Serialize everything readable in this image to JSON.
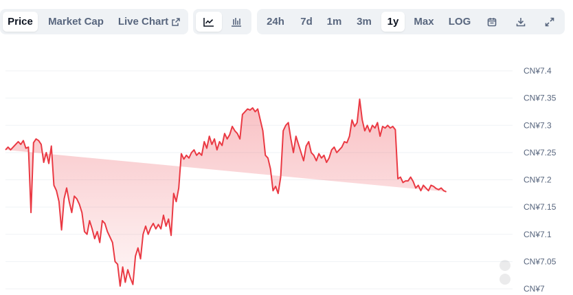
{
  "toolbar": {
    "tab_price": "Price",
    "tab_market_cap": "Market Cap",
    "tab_live_chart": "Live Chart",
    "range_24h": "24h",
    "range_7d": "7d",
    "range_1m": "1m",
    "range_3m": "3m",
    "range_1y": "1y",
    "range_max": "Max",
    "scale_log": "LOG"
  },
  "colors": {
    "line": "#ea3943",
    "fill_top": "#ea3943",
    "grid": "#eff2f5"
  },
  "chart_data": {
    "type": "area",
    "ylim": [
      7.0,
      7.4
    ],
    "y_ticks": [
      7.4,
      7.35,
      7.3,
      7.25,
      7.2,
      7.15,
      7.1,
      7.05,
      7.0
    ],
    "y_tick_labels": [
      "CN¥7.4",
      "CN¥7.35",
      "CN¥7.3",
      "CN¥7.25",
      "CN¥7.2",
      "CN¥7.15",
      "CN¥7.1",
      "CN¥7.05",
      "CN¥7"
    ],
    "x": [
      0,
      1,
      2,
      3,
      4,
      5,
      6,
      7,
      8,
      9,
      10,
      11,
      12,
      13,
      14,
      15,
      16,
      17,
      18,
      19,
      20,
      21,
      22,
      23,
      24,
      25,
      26,
      27,
      28,
      29,
      30,
      31,
      32,
      33,
      34,
      35,
      36,
      37,
      38,
      39,
      40,
      41,
      42,
      43,
      44,
      45,
      46,
      47,
      48,
      49,
      50,
      51,
      52,
      53,
      54,
      55,
      56,
      57,
      58,
      59,
      60,
      61,
      62,
      63,
      64,
      65,
      66,
      67,
      68,
      69,
      70,
      71,
      72,
      73,
      74,
      75,
      76,
      77,
      78,
      79,
      80,
      81,
      82,
      83,
      84,
      85,
      86,
      87,
      88,
      89,
      90,
      91,
      92,
      93,
      94,
      95,
      96,
      97,
      98,
      99,
      100,
      101,
      102,
      103,
      104,
      105,
      106,
      107,
      108,
      109,
      110,
      111,
      112,
      113,
      114,
      115,
      116,
      117,
      118,
      119,
      120,
      121,
      122,
      123,
      124,
      125,
      126,
      127,
      128,
      129,
      130,
      131,
      132,
      133,
      134,
      135,
      136,
      137,
      138,
      139,
      140,
      141,
      142,
      143,
      144,
      145,
      146,
      147,
      148,
      149,
      150,
      151,
      152,
      153,
      154,
      155,
      156,
      157,
      158,
      159,
      160,
      161,
      162,
      163,
      164,
      165,
      166,
      167,
      168,
      169,
      170,
      171,
      172,
      173,
      174,
      175,
      176,
      177,
      178,
      179,
      180,
      181,
      182,
      183,
      184,
      185,
      186,
      187,
      188,
      189,
      190,
      191,
      192,
      193,
      194,
      195,
      196,
      197,
      198,
      199
    ],
    "values": [
      7.255,
      7.26,
      7.255,
      7.26,
      7.265,
      7.27,
      7.265,
      7.272,
      7.258,
      7.26,
      7.14,
      7.268,
      7.275,
      7.272,
      7.265,
      7.232,
      7.25,
      7.23,
      7.262,
      7.19,
      7.18,
      7.16,
      7.108,
      7.165,
      7.185,
      7.16,
      7.14,
      7.17,
      7.165,
      7.155,
      7.14,
      7.105,
      7.1,
      7.125,
      7.11,
      7.092,
      7.105,
      7.085,
      7.125,
      7.12,
      7.105,
      7.095,
      7.085,
      7.05,
      7.045,
      7.005,
      7.04,
      7.012,
      7.035,
      7.02,
      7.008,
      7.06,
      7.075,
      7.055,
      7.1,
      7.115,
      7.1,
      7.112,
      7.12,
      7.11,
      7.118,
      7.11,
      7.135,
      7.115,
      7.128,
      7.098,
      7.175,
      7.16,
      7.185,
      7.248,
      7.238,
      7.245,
      7.24,
      7.25,
      7.255,
      7.245,
      7.25,
      7.245,
      7.27,
      7.258,
      7.28,
      7.265,
      7.275,
      7.255,
      7.27,
      7.263,
      7.285,
      7.275,
      7.283,
      7.298,
      7.29,
      7.285,
      7.275,
      7.32,
      7.325,
      7.33,
      7.328,
      7.332,
      7.325,
      7.33,
      7.31,
      7.29,
      7.245,
      7.24,
      7.22,
      7.18,
      7.188,
      7.175,
      7.205,
      7.29,
      7.3,
      7.305,
      7.275,
      7.25,
      7.28,
      7.265,
      7.25,
      7.235,
      7.262,
      7.27,
      7.25,
      7.245,
      7.235,
      7.248,
      7.24,
      7.245,
      7.232,
      7.24,
      7.255,
      7.26,
      7.25,
      7.255,
      7.26,
      7.27,
      7.268,
      7.28,
      7.31,
      7.298,
      7.305,
      7.348,
      7.31,
      7.29,
      7.3,
      7.288,
      7.3,
      7.295,
      7.305,
      7.28,
      7.298,
      7.295,
      7.3,
      7.295,
      7.298,
      7.292,
      7.202,
      7.205,
      7.195,
      7.198,
      7.198,
      7.205,
      7.197,
      7.185,
      7.19,
      7.18,
      7.19,
      7.185,
      7.18,
      7.19,
      7.188,
      7.184,
      7.182,
      7.185,
      7.18,
      7.178
    ]
  }
}
